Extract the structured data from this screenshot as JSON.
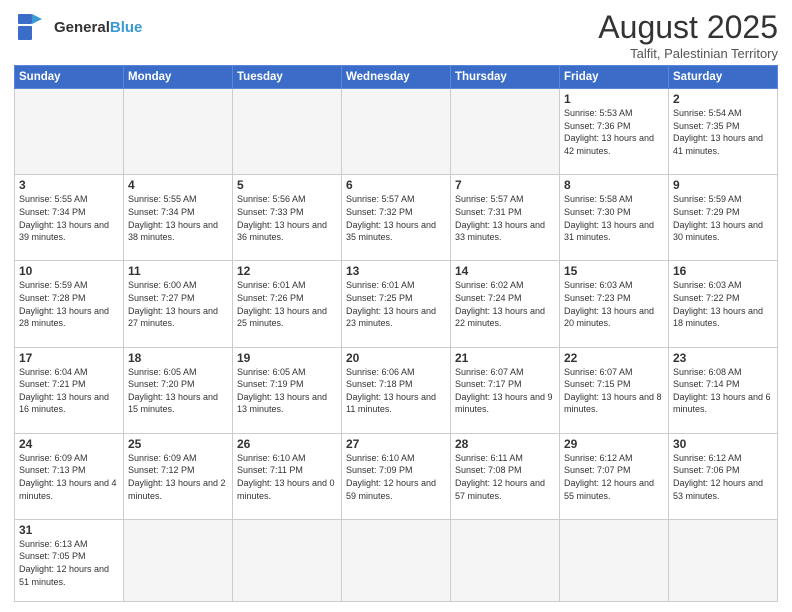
{
  "header": {
    "logo_general": "General",
    "logo_blue": "Blue",
    "title": "August 2025",
    "subtitle": "Talfit, Palestinian Territory"
  },
  "days_of_week": [
    "Sunday",
    "Monday",
    "Tuesday",
    "Wednesday",
    "Thursday",
    "Friday",
    "Saturday"
  ],
  "weeks": [
    [
      {
        "day": "",
        "info": ""
      },
      {
        "day": "",
        "info": ""
      },
      {
        "day": "",
        "info": ""
      },
      {
        "day": "",
        "info": ""
      },
      {
        "day": "",
        "info": ""
      },
      {
        "day": "1",
        "info": "Sunrise: 5:53 AM\nSunset: 7:36 PM\nDaylight: 13 hours and 42 minutes."
      },
      {
        "day": "2",
        "info": "Sunrise: 5:54 AM\nSunset: 7:35 PM\nDaylight: 13 hours and 41 minutes."
      }
    ],
    [
      {
        "day": "3",
        "info": "Sunrise: 5:55 AM\nSunset: 7:34 PM\nDaylight: 13 hours and 39 minutes."
      },
      {
        "day": "4",
        "info": "Sunrise: 5:55 AM\nSunset: 7:34 PM\nDaylight: 13 hours and 38 minutes."
      },
      {
        "day": "5",
        "info": "Sunrise: 5:56 AM\nSunset: 7:33 PM\nDaylight: 13 hours and 36 minutes."
      },
      {
        "day": "6",
        "info": "Sunrise: 5:57 AM\nSunset: 7:32 PM\nDaylight: 13 hours and 35 minutes."
      },
      {
        "day": "7",
        "info": "Sunrise: 5:57 AM\nSunset: 7:31 PM\nDaylight: 13 hours and 33 minutes."
      },
      {
        "day": "8",
        "info": "Sunrise: 5:58 AM\nSunset: 7:30 PM\nDaylight: 13 hours and 31 minutes."
      },
      {
        "day": "9",
        "info": "Sunrise: 5:59 AM\nSunset: 7:29 PM\nDaylight: 13 hours and 30 minutes."
      }
    ],
    [
      {
        "day": "10",
        "info": "Sunrise: 5:59 AM\nSunset: 7:28 PM\nDaylight: 13 hours and 28 minutes."
      },
      {
        "day": "11",
        "info": "Sunrise: 6:00 AM\nSunset: 7:27 PM\nDaylight: 13 hours and 27 minutes."
      },
      {
        "day": "12",
        "info": "Sunrise: 6:01 AM\nSunset: 7:26 PM\nDaylight: 13 hours and 25 minutes."
      },
      {
        "day": "13",
        "info": "Sunrise: 6:01 AM\nSunset: 7:25 PM\nDaylight: 13 hours and 23 minutes."
      },
      {
        "day": "14",
        "info": "Sunrise: 6:02 AM\nSunset: 7:24 PM\nDaylight: 13 hours and 22 minutes."
      },
      {
        "day": "15",
        "info": "Sunrise: 6:03 AM\nSunset: 7:23 PM\nDaylight: 13 hours and 20 minutes."
      },
      {
        "day": "16",
        "info": "Sunrise: 6:03 AM\nSunset: 7:22 PM\nDaylight: 13 hours and 18 minutes."
      }
    ],
    [
      {
        "day": "17",
        "info": "Sunrise: 6:04 AM\nSunset: 7:21 PM\nDaylight: 13 hours and 16 minutes."
      },
      {
        "day": "18",
        "info": "Sunrise: 6:05 AM\nSunset: 7:20 PM\nDaylight: 13 hours and 15 minutes."
      },
      {
        "day": "19",
        "info": "Sunrise: 6:05 AM\nSunset: 7:19 PM\nDaylight: 13 hours and 13 minutes."
      },
      {
        "day": "20",
        "info": "Sunrise: 6:06 AM\nSunset: 7:18 PM\nDaylight: 13 hours and 11 minutes."
      },
      {
        "day": "21",
        "info": "Sunrise: 6:07 AM\nSunset: 7:17 PM\nDaylight: 13 hours and 9 minutes."
      },
      {
        "day": "22",
        "info": "Sunrise: 6:07 AM\nSunset: 7:15 PM\nDaylight: 13 hours and 8 minutes."
      },
      {
        "day": "23",
        "info": "Sunrise: 6:08 AM\nSunset: 7:14 PM\nDaylight: 13 hours and 6 minutes."
      }
    ],
    [
      {
        "day": "24",
        "info": "Sunrise: 6:09 AM\nSunset: 7:13 PM\nDaylight: 13 hours and 4 minutes."
      },
      {
        "day": "25",
        "info": "Sunrise: 6:09 AM\nSunset: 7:12 PM\nDaylight: 13 hours and 2 minutes."
      },
      {
        "day": "26",
        "info": "Sunrise: 6:10 AM\nSunset: 7:11 PM\nDaylight: 13 hours and 0 minutes."
      },
      {
        "day": "27",
        "info": "Sunrise: 6:10 AM\nSunset: 7:09 PM\nDaylight: 12 hours and 59 minutes."
      },
      {
        "day": "28",
        "info": "Sunrise: 6:11 AM\nSunset: 7:08 PM\nDaylight: 12 hours and 57 minutes."
      },
      {
        "day": "29",
        "info": "Sunrise: 6:12 AM\nSunset: 7:07 PM\nDaylight: 12 hours and 55 minutes."
      },
      {
        "day": "30",
        "info": "Sunrise: 6:12 AM\nSunset: 7:06 PM\nDaylight: 12 hours and 53 minutes."
      }
    ],
    [
      {
        "day": "31",
        "info": "Sunrise: 6:13 AM\nSunset: 7:05 PM\nDaylight: 12 hours and 51 minutes."
      },
      {
        "day": "",
        "info": ""
      },
      {
        "day": "",
        "info": ""
      },
      {
        "day": "",
        "info": ""
      },
      {
        "day": "",
        "info": ""
      },
      {
        "day": "",
        "info": ""
      },
      {
        "day": "",
        "info": ""
      }
    ]
  ]
}
